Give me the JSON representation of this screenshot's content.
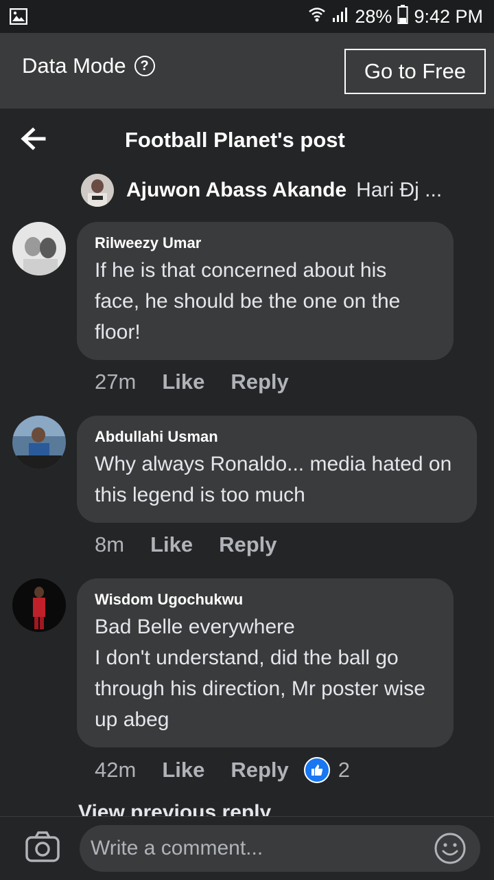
{
  "status_bar": {
    "battery": "28%",
    "time": "9:42 PM"
  },
  "data_bar": {
    "label": "Data Mode",
    "help_symbol": "?",
    "go_free_label": "Go to Free"
  },
  "nav": {
    "title": "Football Planet's post"
  },
  "parent_comment": {
    "author": "Ajuwon Abass Akande",
    "text": "Hari Đj ..."
  },
  "comments": [
    {
      "author": "Rilweezy Umar",
      "text": "If he is that concerned about his face, he should be the one on the floor!",
      "time": "27m",
      "like_label": "Like",
      "reply_label": "Reply"
    },
    {
      "author": "Abdullahi Usman",
      "text": "Why always Ronaldo... media hated on this legend is too much",
      "time": "8m",
      "like_label": "Like",
      "reply_label": "Reply"
    },
    {
      "author": "Wisdom Ugochukwu",
      "text": "Bad Belle everywhere\nI don't understand, did the ball go through his direction, Mr poster wise up abeg",
      "time": "42m",
      "like_label": "Like",
      "reply_label": "Reply",
      "reaction_count": "2"
    }
  ],
  "view_previous": "View previous reply",
  "composer": {
    "placeholder": "Write a comment..."
  },
  "colors": {
    "background": "#242526",
    "bubble": "#3a3b3c",
    "like_blue": "#1877f2",
    "muted_text": "#b0b3b8"
  },
  "icons": [
    "gallery-icon",
    "wifi-icon",
    "signal-icon",
    "battery-icon",
    "help-icon",
    "back-arrow-icon",
    "like-reaction-icon",
    "camera-icon",
    "smiley-icon"
  ]
}
